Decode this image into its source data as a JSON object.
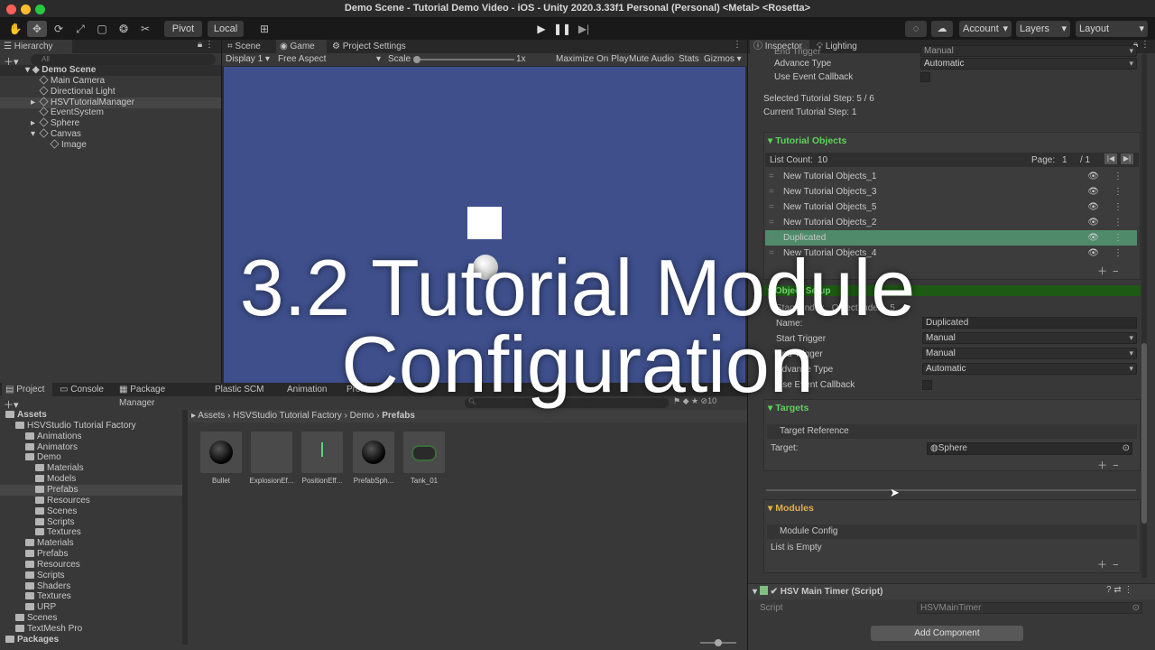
{
  "window": {
    "title": "Demo Scene - Tutorial Demo Video - iOS - Unity 2020.3.33f1 Personal (Personal) <Metal> <Rosetta>",
    "traffic_colors": [
      "#ff5f57",
      "#febc2e",
      "#28c840"
    ]
  },
  "toolbar": {
    "pivot": "Pivot",
    "local": "Local",
    "account": "Account",
    "layers": "Layers",
    "layout": "Layout"
  },
  "hierarchy": {
    "tab": "Hierarchy",
    "search_placeholder": "All",
    "scene": "Demo Scene",
    "items": [
      "Main Camera",
      "Directional Light",
      "HSVTutorialManager",
      "EventSystem",
      "Sphere",
      "Canvas",
      "Image"
    ]
  },
  "game": {
    "tabs": [
      "Scene",
      "Game",
      "Project Settings"
    ],
    "display": "Display 1",
    "aspect": "Free Aspect",
    "scale_label": "Scale",
    "scale_value": "1x",
    "buttons": [
      "Maximize On Play",
      "Mute Audio",
      "Stats",
      "Gizmos"
    ],
    "bg_color": "#3e4f8c"
  },
  "project": {
    "tabs": [
      "Project",
      "Console",
      "Package Manager",
      "Plastic SCM",
      "Animation",
      "Profiler"
    ],
    "tree": [
      {
        "label": "Assets",
        "indent": 0,
        "bold": true
      },
      {
        "label": "HSVStudio Tutorial Factory",
        "indent": 1
      },
      {
        "label": "Animations",
        "indent": 2
      },
      {
        "label": "Animators",
        "indent": 2
      },
      {
        "label": "Demo",
        "indent": 2
      },
      {
        "label": "Materials",
        "indent": 3
      },
      {
        "label": "Models",
        "indent": 3
      },
      {
        "label": "Prefabs",
        "indent": 3,
        "selected": true
      },
      {
        "label": "Resources",
        "indent": 3
      },
      {
        "label": "Scenes",
        "indent": 3
      },
      {
        "label": "Scripts",
        "indent": 3
      },
      {
        "label": "Textures",
        "indent": 3
      },
      {
        "label": "Materials",
        "indent": 2
      },
      {
        "label": "Prefabs",
        "indent": 2
      },
      {
        "label": "Resources",
        "indent": 2
      },
      {
        "label": "Scripts",
        "indent": 2
      },
      {
        "label": "Shaders",
        "indent": 2
      },
      {
        "label": "Textures",
        "indent": 2
      },
      {
        "label": "URP",
        "indent": 2
      },
      {
        "label": "Scenes",
        "indent": 1
      },
      {
        "label": "TextMesh Pro",
        "indent": 1
      },
      {
        "label": "Packages",
        "indent": 0,
        "bold": true
      }
    ],
    "breadcrumb": [
      "Assets",
      "HSVStudio Tutorial Factory",
      "Demo",
      "Prefabs"
    ],
    "hidden_count": "10",
    "assets": [
      "Bullet",
      "ExplosionEf...",
      "PositionEff...",
      "PrefabSph...",
      "Tank_01"
    ]
  },
  "inspector": {
    "tabs": [
      "Inspector",
      "Lighting"
    ],
    "end_trigger_label": "End Trigger",
    "end_trigger_value": "Manual",
    "advance_type_label": "Advance Type",
    "advance_type_value": "Automatic",
    "use_event_callback": "Use Event Callback",
    "selected_step": "Selected Tutorial Step: 5 / 6",
    "current_step": "Current Tutorial Step: 1",
    "tutorial_objects_header": "Tutorial Objects",
    "list_count_label": "List Count:",
    "list_count_value": "10",
    "page_label": "Page:",
    "page_value": "1",
    "page_total": "/ 1",
    "list_items": [
      "New Tutorial Objects_1",
      "New Tutorial Objects_3",
      "New Tutorial Objects_5",
      "New Tutorial Objects_2",
      "Duplicated",
      "New Tutorial Objects_4"
    ],
    "object_setup": "Object Setup",
    "stage_index": "Stage Index",
    "object_index": "Object Index",
    "object_index_value": "5",
    "name_label": "Name:",
    "name_value": "Duplicated",
    "start_trigger_label": "Start Trigger",
    "start_trigger_value": "Manual",
    "end_trigger2_value": "Manual",
    "advance_type2_value": "Automatic",
    "targets_header": "Targets",
    "target_reference": "Target Reference",
    "target_label": "Target:",
    "target_value": "Sphere",
    "modules_header": "Modules",
    "module_config": "Module Config",
    "list_empty": "List is Empty",
    "component": "HSV Main Timer (Script)",
    "script_label": "Script",
    "script_value": "HSVMainTimer",
    "add_component": "Add Component",
    "accent_green": "#5cd35c",
    "accent_yellow": "#e0b04a",
    "selected_row_color": "#4f8a6a"
  },
  "overlay": {
    "line1": "3.2 Tutorial Module",
    "line2": "Configuration"
  }
}
